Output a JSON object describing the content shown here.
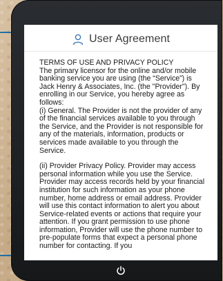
{
  "header": {
    "title": "User Agreement",
    "icon": "user-icon"
  },
  "agreement": {
    "heading": "TERMS OF USE AND PRIVACY POLICY",
    "intro": "The primary licensor for the online and/or mobile banking service you are using (the “Service”) is Jack Henry & Associates, Inc. (the \"Provider\"). By enrolling in our Service, you hereby agree as follows:",
    "section_i": "(i) General. The Provider is not the provider of any of the financial services available to you through the Service, and the Provider is not responsible for any of the materials, information, products or services made available to you through the Service.",
    "section_ii": "(ii) Provider Privacy Policy. Provider may access personal information while you use the Service. Provider may access records held by your financial institution for such information as your phone number, home address or email address. Provider will use this contact information to alert you about Service-related events or actions that require your attention. If you grant permission to use phone information, Provider will use the phone number to pre-populate forms that expect a personal phone number for contacting. If you"
  },
  "footer": {
    "icon": "power-icon"
  },
  "colors": {
    "accent": "#1f6fa6",
    "device": "#1c1e21",
    "screen": "#ffffff"
  }
}
